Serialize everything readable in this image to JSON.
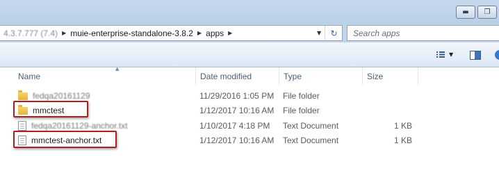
{
  "window": {
    "minimize_glyph": "▬",
    "maximize_glyph": "❐"
  },
  "address": {
    "obscured_prefix": "4.3.7.777 (7.4)",
    "crumbs": [
      "muie-enterprise-standalone-3.8.2",
      "apps"
    ],
    "separator": "▶",
    "dropdown_glyph": "▼",
    "refresh_glyph": "↻"
  },
  "search": {
    "placeholder": "Search apps"
  },
  "toolbar": {
    "view_dropdown_glyph": "▼"
  },
  "columns": {
    "name": "Name",
    "date_modified": "Date modified",
    "type": "Type",
    "size": "Size",
    "sort_glyph": "▲"
  },
  "files": [
    {
      "name": "fedqa20161129",
      "date": "11/29/2016 1:05 PM",
      "type": "File folder",
      "size": "",
      "icon": "folder-icon",
      "obscured": true
    },
    {
      "name": "mmctest",
      "date": "1/12/2017 10:16 AM",
      "type": "File folder",
      "size": "",
      "icon": "folder-icon",
      "obscured": false
    },
    {
      "name": "fedqa20161129-anchor.txt",
      "date": "1/10/2017 4:18 PM",
      "type": "Text Document",
      "size": "1 KB",
      "icon": "document-icon",
      "obscured": true
    },
    {
      "name": "mmctest-anchor.txt",
      "date": "1/12/2017 10:16 AM",
      "type": "Text Document",
      "size": "1 KB",
      "icon": "document-icon",
      "obscured": false
    }
  ],
  "colors": {
    "highlight": "#b01e1e",
    "title_bar": "#c0d4ec"
  }
}
